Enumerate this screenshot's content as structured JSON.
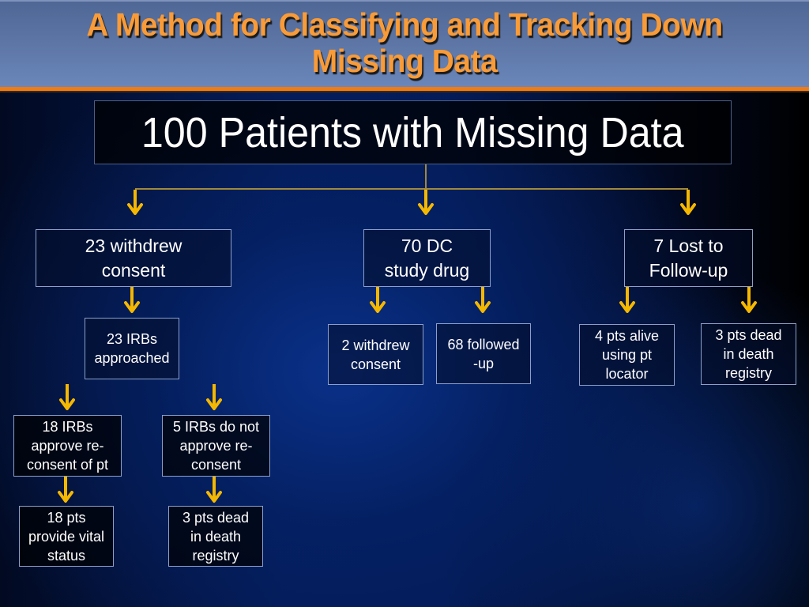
{
  "slide": {
    "title": "A Method for Classifying and Tracking Down\nMissing Data",
    "colors": {
      "title_text": "#f89b38",
      "title_rule": "#f07a14",
      "arrow": "#f5b800",
      "connector_line": "#a08a3a",
      "box_border": "#8aa0cc"
    }
  },
  "flowchart": {
    "root": {
      "label": "100 Patients with Missing Data"
    },
    "branches": [
      {
        "label": "23 withdrew\nconsent",
        "children": [
          {
            "label": "23 IRBs\napproached",
            "children": [
              {
                "label": "18 IRBs\napprove re-\nconsent of pt",
                "children": [
                  {
                    "label": "18 pts\nprovide vital\nstatus"
                  }
                ]
              },
              {
                "label": "5 IRBs do not\napprove re-\nconsent",
                "children": [
                  {
                    "label": "3 pts dead\nin death\nregistry"
                  }
                ]
              }
            ]
          }
        ]
      },
      {
        "label": "70 DC\nstudy drug",
        "children": [
          {
            "label": "2 withdrew\nconsent"
          },
          {
            "label": "68 followed\n-up"
          }
        ]
      },
      {
        "label": "7 Lost to\nFollow-up",
        "children": [
          {
            "label": "4 pts alive\nusing pt\nlocator"
          },
          {
            "label": "3 pts dead\nin death\nregistry"
          }
        ]
      }
    ]
  }
}
